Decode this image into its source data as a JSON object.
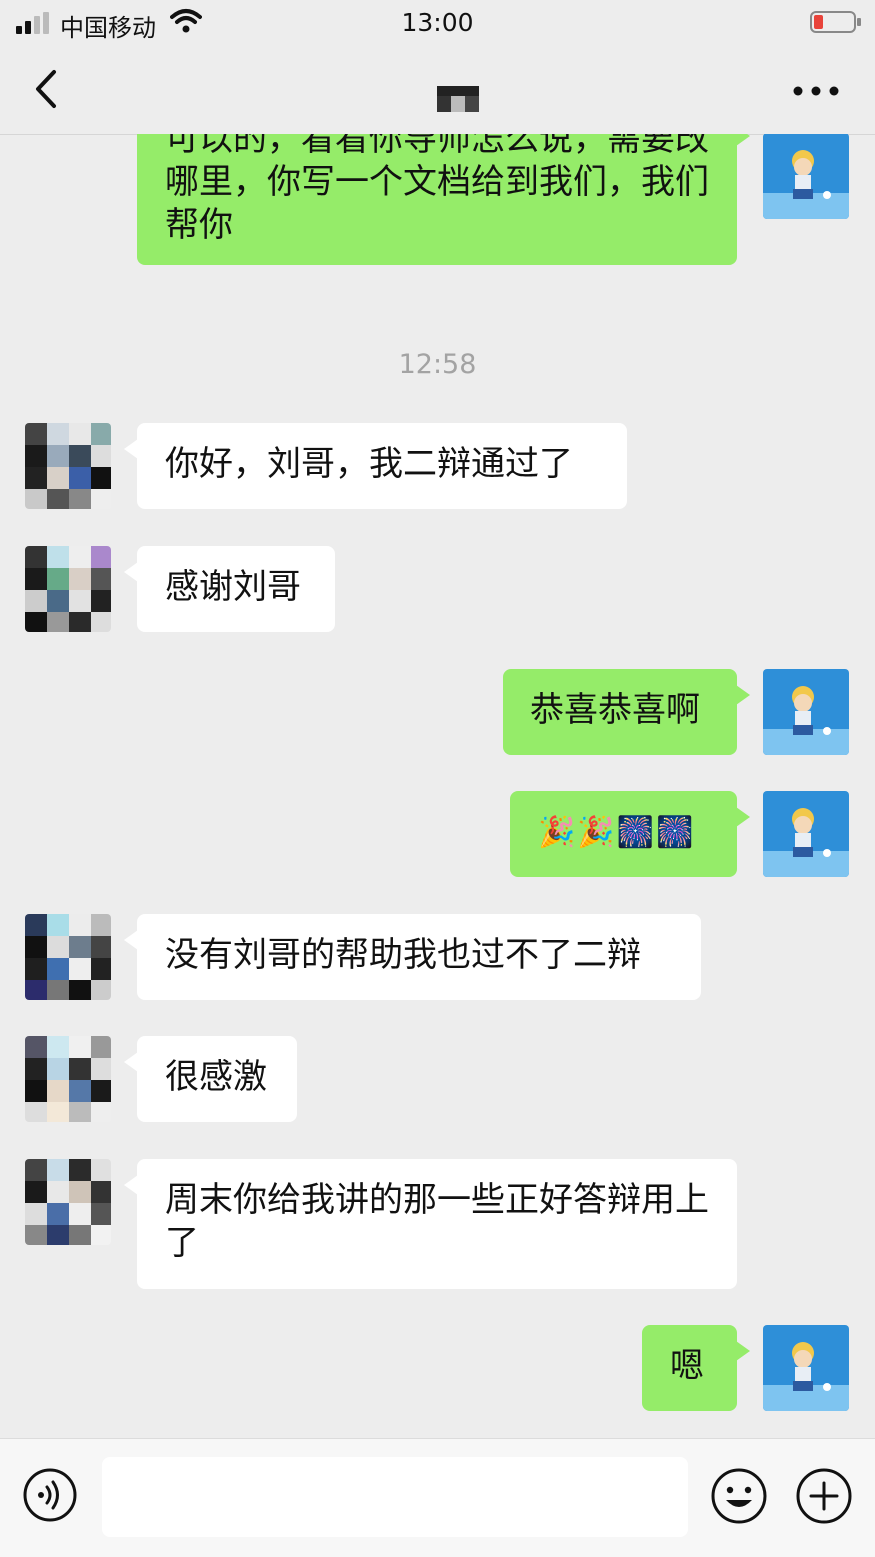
{
  "status_bar": {
    "carrier": "中国移动",
    "time": "13:00"
  },
  "nav": {
    "title": ""
  },
  "timestamp": "12:58",
  "messages": [
    {
      "side": "out",
      "text": "可以的，看看你导师怎么说，需要改哪里，你写一个文档给到我们，我们帮你"
    },
    {
      "side": "in",
      "text": "你好，刘哥，我二辩通过了"
    },
    {
      "side": "in",
      "text": "感谢刘哥"
    },
    {
      "side": "out",
      "text": "恭喜恭喜啊"
    },
    {
      "side": "out",
      "text": "🎉🎉🎆🎆"
    },
    {
      "side": "in",
      "text": "没有刘哥的帮助我也过不了二辩"
    },
    {
      "side": "in",
      "text": "很感激"
    },
    {
      "side": "in",
      "text": "周末你给我讲的那一些正好答辩用上了"
    },
    {
      "side": "out",
      "text": "嗯"
    }
  ],
  "input": {
    "value": "",
    "placeholder": ""
  },
  "icons": {
    "back": "chevron-left-icon",
    "more": "more-dots-icon",
    "voice": "voice-icon",
    "emoji": "emoji-icon",
    "plus": "plus-icon"
  },
  "colors": {
    "outgoing_bubble": "#95ec69",
    "incoming_bubble": "#ffffff",
    "background": "#ededed"
  }
}
